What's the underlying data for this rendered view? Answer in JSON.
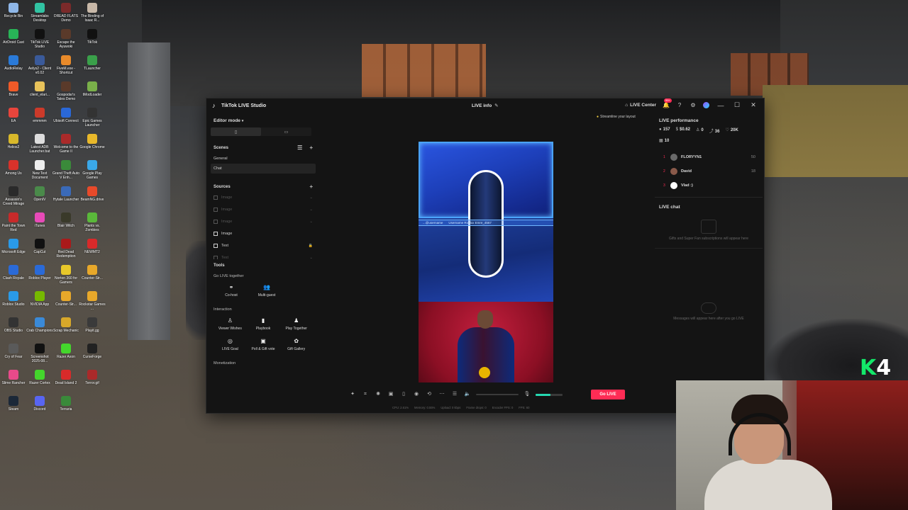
{
  "desktop": {
    "icons": [
      {
        "label": "Recycle Bin",
        "color": "#8fb7e8"
      },
      {
        "label": "Streamlabs Desktop",
        "color": "#31c3a2"
      },
      {
        "label": "DREAD FLATS Demo",
        "color": "#7a2a2a"
      },
      {
        "label": "The Binding of Isaac R...",
        "color": "#c8b8a8"
      },
      {
        "label": "AirDroid Cast",
        "color": "#28b457"
      },
      {
        "label": "TikTok LIVE Studio",
        "color": "#111111"
      },
      {
        "label": "Escape the Ayuwoki",
        "color": "#5a3a2a"
      },
      {
        "label": "TikTok",
        "color": "#111111"
      },
      {
        "label": "AudioRelay",
        "color": "#2a7ad8"
      },
      {
        "label": "Aelys2 - Client v0.02",
        "color": "#3a5a9a"
      },
      {
        "label": "FiveM.exe - Shortcut",
        "color": "#e88a2a"
      },
      {
        "label": "TLauncher",
        "color": "#3aa04a"
      },
      {
        "label": "Brave",
        "color": "#f05a28"
      },
      {
        "label": "client_elari...",
        "color": "#e8c25a"
      },
      {
        "label": "Gospodar's Tales Demo",
        "color": "#5a3a2a"
      },
      {
        "label": "tModLoader",
        "color": "#7ab04a"
      },
      {
        "label": "EA",
        "color": "#e8453c"
      },
      {
        "label": "emmmm",
        "color": "#cc3a2a"
      },
      {
        "label": "Ubisoft Connect",
        "color": "#2a68d8"
      },
      {
        "label": "Epic Games Launcher",
        "color": "#333333"
      },
      {
        "label": "Helios2",
        "color": "#d8b82a"
      },
      {
        "label": "Latest ADB Launcher.bat",
        "color": "#dddddd"
      },
      {
        "label": "Welcome to the Game II",
        "color": "#aa2a2a"
      },
      {
        "label": "Google Chrome",
        "color": "#e8b82a"
      },
      {
        "label": "Among Us",
        "color": "#d8322a"
      },
      {
        "label": "New Text Document",
        "color": "#eeeeee"
      },
      {
        "label": "Grand Theft Auto V Enh...",
        "color": "#3a8a3a"
      },
      {
        "label": "Google Play Games",
        "color": "#3aa8e8"
      },
      {
        "label": "Assassin's Creed Mirage",
        "color": "#2a2a2a"
      },
      {
        "label": "OpenIV",
        "color": "#4a8a4a"
      },
      {
        "label": "Hytale Launcher",
        "color": "#3a6ab8"
      },
      {
        "label": "BeamNG.drive",
        "color": "#e84a2a"
      },
      {
        "label": "Paint the Town Red",
        "color": "#c82a2a"
      },
      {
        "label": "iTunes",
        "color": "#e84ab8"
      },
      {
        "label": "Blair Witch",
        "color": "#3a3a2a"
      },
      {
        "label": "Plants vs. Zombies",
        "color": "#5ab83a"
      },
      {
        "label": "Microsoft Edge",
        "color": "#2a9ae8"
      },
      {
        "label": "CapCut",
        "color": "#111111"
      },
      {
        "label": "Red Dead Redemption",
        "color": "#aa1a1a"
      },
      {
        "label": "NEWMT2",
        "color": "#d82a2a"
      },
      {
        "label": "Clash Royale",
        "color": "#2a6ad8"
      },
      {
        "label": "Roblox Player",
        "color": "#2a6ad8"
      },
      {
        "label": "Norton 360 for Gamers",
        "color": "#e8c82a"
      },
      {
        "label": "Counter-Str...",
        "color": "#e8a82a"
      },
      {
        "label": "Roblox Studio",
        "color": "#2a9ae8"
      },
      {
        "label": "NVIDIA App",
        "color": "#76b900"
      },
      {
        "label": "Counter-Str...",
        "color": "#e8a82a"
      },
      {
        "label": "Rockstar Games ...",
        "color": "#e8a82a"
      },
      {
        "label": "OBS Studio",
        "color": "#333333"
      },
      {
        "label": "Crab Champions",
        "color": "#3a8ad8"
      },
      {
        "label": "Scrap Mechanic",
        "color": "#d8a82a"
      },
      {
        "label": "Playit.gg",
        "color": "#3a3a3a"
      },
      {
        "label": "Cry of Fear",
        "color": "#5a5a5a"
      },
      {
        "label": "Screenshot 2025-08...",
        "color": "#111111"
      },
      {
        "label": "Razer Axon",
        "color": "#44d62c"
      },
      {
        "label": "CurseForge",
        "color": "#222222"
      },
      {
        "label": "Slime Rancher",
        "color": "#e84a8a"
      },
      {
        "label": "Razer Cortex",
        "color": "#44d62c"
      },
      {
        "label": "Dead Island 2",
        "color": "#d82a2a"
      },
      {
        "label": "Terror.gif",
        "color": "#aa2a2a"
      },
      {
        "label": "Steam",
        "color": "#1b2838"
      },
      {
        "label": "Discord",
        "color": "#5865f2"
      },
      {
        "label": "Terraria",
        "color": "#3a8a3a"
      }
    ]
  },
  "window": {
    "app_title": "TikTok LIVE Studio",
    "live_info": "LIVE info",
    "live_center": "LIVE Center",
    "badge": "99+",
    "streamline": "Streamline your layout"
  },
  "left": {
    "editor_mode": "Editor mode",
    "scenes_title": "Scenes",
    "scenes": [
      "General",
      "Chat"
    ],
    "sources_title": "Sources",
    "sources": [
      {
        "label": "Image",
        "dim": true
      },
      {
        "label": "Image",
        "dim": true
      },
      {
        "label": "Image",
        "dim": true
      },
      {
        "label": "Image",
        "dim": false
      },
      {
        "label": "Text",
        "dim": false
      },
      {
        "label": "Text",
        "dim": true
      }
    ],
    "tools_title": "Tools",
    "go_live_together": "Go LIVE together",
    "tools_together": [
      {
        "label": "Co-host",
        "icon": "link-icon"
      },
      {
        "label": "Multi-guest",
        "icon": "users-icon"
      }
    ],
    "interaction": "Interaction",
    "tools_interaction": [
      {
        "label": "Viewer Wishes",
        "icon": "wish-icon"
      },
      {
        "label": "Playbook",
        "icon": "book-icon"
      },
      {
        "label": "Play Together",
        "icon": "play-together-icon"
      },
      {
        "label": "LIVE Goal",
        "icon": "goal-icon"
      },
      {
        "label": "Poll & Gift vote",
        "icon": "poll-icon"
      },
      {
        "label": "Gift Gallery",
        "icon": "gift-icon"
      }
    ],
    "monetization": "Monetization"
  },
  "preview": {
    "label_left": "...@username",
    "label_right": "Username Roblox Emre_4567"
  },
  "bottombar": {
    "go_live": "Go LIVE",
    "mic_level": 0.55,
    "stats": [
      "CPU: 2.61%",
      "Memory: 0.55%",
      "Upload: 0 kbps",
      "Frame drops: 0",
      "Encoder FPS: 0",
      "FPS: 60"
    ]
  },
  "right": {
    "perf_title": "LIVE performance",
    "stats": [
      {
        "icon": "viewers-icon",
        "value": "157"
      },
      {
        "icon": "dollar-icon",
        "value": "$0.62"
      },
      {
        "icon": "user-icon",
        "value": "0"
      },
      {
        "icon": "share-icon",
        "value": "36"
      },
      {
        "icon": "heart-icon",
        "value": "20K"
      },
      {
        "icon": "gift-box-icon",
        "value": "10"
      }
    ],
    "ranking": [
      {
        "rank": "1",
        "name": "FLORYYN1",
        "score": "50"
      },
      {
        "rank": "2",
        "name": "David",
        "score": "18"
      },
      {
        "rank": "3",
        "name": "Vlad :)",
        "score": ""
      }
    ],
    "chat_title": "LIVE chat",
    "gift_text": "Gifts and Super Fan subscriptions will appear here",
    "msg_text": "Messages will appear here after you go LIVE"
  },
  "overlay": {
    "logo_k": "K",
    "logo_num": "4"
  }
}
